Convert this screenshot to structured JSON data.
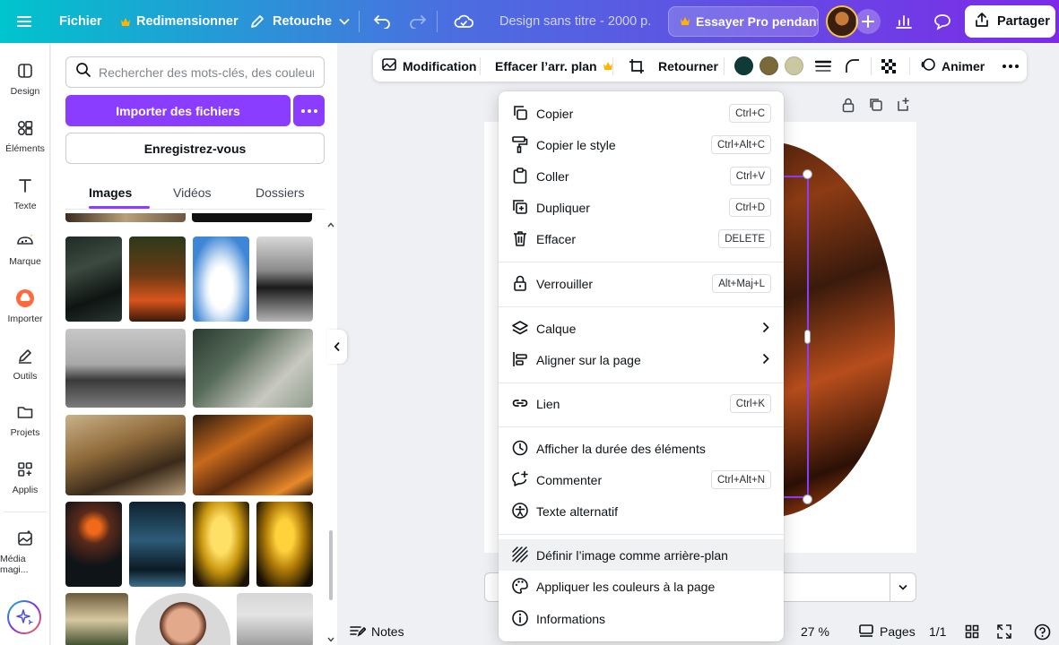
{
  "topbar": {
    "file": "Fichier",
    "resize": "Redimensionner",
    "retouch": "Retouche",
    "doc_title": "Design sans titre - 2000 p...",
    "pro": "Essayer Pro pendant",
    "share": "Partager"
  },
  "rail": [
    {
      "label": "Design",
      "icon": "layout-icon"
    },
    {
      "label": "Éléments",
      "icon": "shapes-icon"
    },
    {
      "label": "Texte",
      "icon": "text-icon"
    },
    {
      "label": "Marque",
      "icon": "brand-icon"
    },
    {
      "label": "Importer",
      "icon": "upload-cloud-icon"
    },
    {
      "label": "Outils",
      "icon": "pen-icon"
    },
    {
      "label": "Projets",
      "icon": "folder-icon"
    },
    {
      "label": "Applis",
      "icon": "apps-icon"
    },
    {
      "label": "Média magi...",
      "icon": "magic-media-icon"
    }
  ],
  "panel": {
    "search_placeholder": "Rechercher des mots-clés, des couleurs",
    "import": "Importer des fichiers",
    "register": "Enregistrez-vous",
    "tabs": [
      "Images",
      "Vidéos",
      "Dossiers"
    ]
  },
  "ctxbar": {
    "edit": "Modification",
    "remove_bg": "Effacer l’arr. plan",
    "flip": "Retourner",
    "animate": "Animer",
    "swatches": [
      "#0f3b36",
      "#7a6a3a",
      "#c9c8a0"
    ]
  },
  "menu": {
    "items": [
      {
        "label": "Copier",
        "shortcut": "Ctrl+C"
      },
      {
        "label": "Copier le style",
        "shortcut": "Ctrl+Alt+C"
      },
      {
        "label": "Coller",
        "shortcut": "Ctrl+V"
      },
      {
        "label": "Dupliquer",
        "shortcut": "Ctrl+D"
      },
      {
        "label": "Effacer",
        "shortcut": "DELETE"
      },
      {
        "label": "Verrouiller",
        "shortcut": "Alt+Maj+L"
      },
      {
        "label": "Calque"
      },
      {
        "label": "Aligner sur la page"
      },
      {
        "label": "Lien",
        "shortcut": "Ctrl+K"
      },
      {
        "label": "Afficher la durée des éléments"
      },
      {
        "label": "Commenter",
        "shortcut": "Ctrl+Alt+N"
      },
      {
        "label": "Texte alternatif"
      },
      {
        "label": "Définir l’image comme arrière-plan"
      },
      {
        "label": "Appliquer les couleurs à la page"
      },
      {
        "label": "Informations"
      }
    ]
  },
  "bottombar": {
    "notes": "Notes",
    "zoom": "27 %",
    "pages": "Pages",
    "page_count": "1/1"
  },
  "colors": {
    "accent": "#8b3dff",
    "selection": "#8b3dff"
  }
}
